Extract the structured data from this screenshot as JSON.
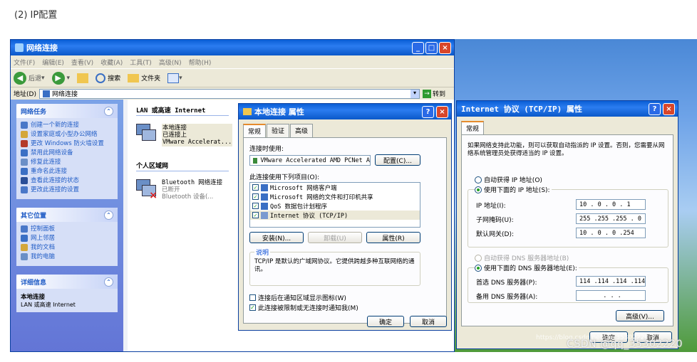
{
  "caption": "(2) IP配置",
  "net": {
    "title": "网络连接",
    "menu": [
      "文件(F)",
      "编辑(E)",
      "查看(V)",
      "收藏(A)",
      "工具(T)",
      "高级(N)",
      "帮助(H)"
    ],
    "back": "后退",
    "search": "搜索",
    "folders": "文件夹",
    "address_label": "地址(D)",
    "address_value": "网络连接",
    "go": "转到",
    "tasks_head": "网络任务",
    "tasks": [
      "创建一个新的连接",
      "设置家庭或小型办公网络",
      "更改 Windows 防火墙设置",
      "禁用此网络设备",
      "修复此连接",
      "重命名此连接",
      "查看此连接的状态",
      "更改此连接的设置"
    ],
    "other_head": "其它位置",
    "other": [
      "控制面板",
      "网上邻居",
      "我的文档",
      "我的电脑"
    ],
    "detail_head": "详细信息",
    "detail_title": "本地连接",
    "detail_sub": "LAN 或高速 Internet",
    "group_lan": "LAN 或高速 Internet",
    "lan_name": "本地连接",
    "lan_status": "已连接上",
    "lan_device": "VMware Accelerat...",
    "group_pan": "个人区域网",
    "bt_name": "Bluetooth 网络连接",
    "bt_status": "已断开",
    "bt_device": "Bluetooth 设备(..."
  },
  "props": {
    "title": "本地连接 属性",
    "tabs": [
      "常规",
      "验证",
      "高级"
    ],
    "connect_using": "连接时使用:",
    "adapter": "VMware Accelerated AMD PCNet A",
    "configure": "配置(C)...",
    "items_label": "此连接使用下列项目(O):",
    "items": [
      "Microsoft 网络客户端",
      "Microsoft 网络的文件和打印机共享",
      "QoS 数据包计划程序",
      "Internet 协议 (TCP/IP)"
    ],
    "install": "安装(N)...",
    "uninstall": "卸载(U)",
    "properties": "属性(R)",
    "desc_title": "说明",
    "desc_text": "TCP/IP 是默认的广域网协议。它提供跨越多种互联网络的通讯。",
    "show_icon": "连接后在通知区域显示图标(W)",
    "notify": "此连接被限制或无连接时通知我(M)",
    "ok": "确定",
    "cancel": "取消"
  },
  "tcp": {
    "title": "Internet 协议 (TCP/IP) 属性",
    "tab": "常规",
    "intro": "如果网络支持此功能，则可以获取自动指派的 IP 设置。否则，您需要从网络系统管理员处获得适当的 IP 设置。",
    "auto_ip": "自动获得 IP 地址(O)",
    "use_ip": "使用下面的 IP 地址(S):",
    "ip_label": "IP 地址(I):",
    "ip_value": "10 . 0 . 0 . 1",
    "mask_label": "子网掩码(U):",
    "mask_value": "255 .255 .255 . 0",
    "gw_label": "默认网关(D):",
    "gw_value": "10 . 0 . 0 .254",
    "auto_dns": "自动获得 DNS 服务器地址(B)",
    "use_dns": "使用下面的 DNS 服务器地址(E):",
    "dns1_label": "首选 DNS 服务器(P):",
    "dns1_value": "114 .114 .114 .114",
    "dns2_label": "备用 DNS 服务器(A):",
    "dns2_value": ". . .",
    "advanced": "高级(V)...",
    "ok": "确定",
    "cancel": "取消"
  },
  "watermark": "CSDN @qq_35302220",
  "watermark_url": "https://blog.csdn.net/qq_35302220"
}
